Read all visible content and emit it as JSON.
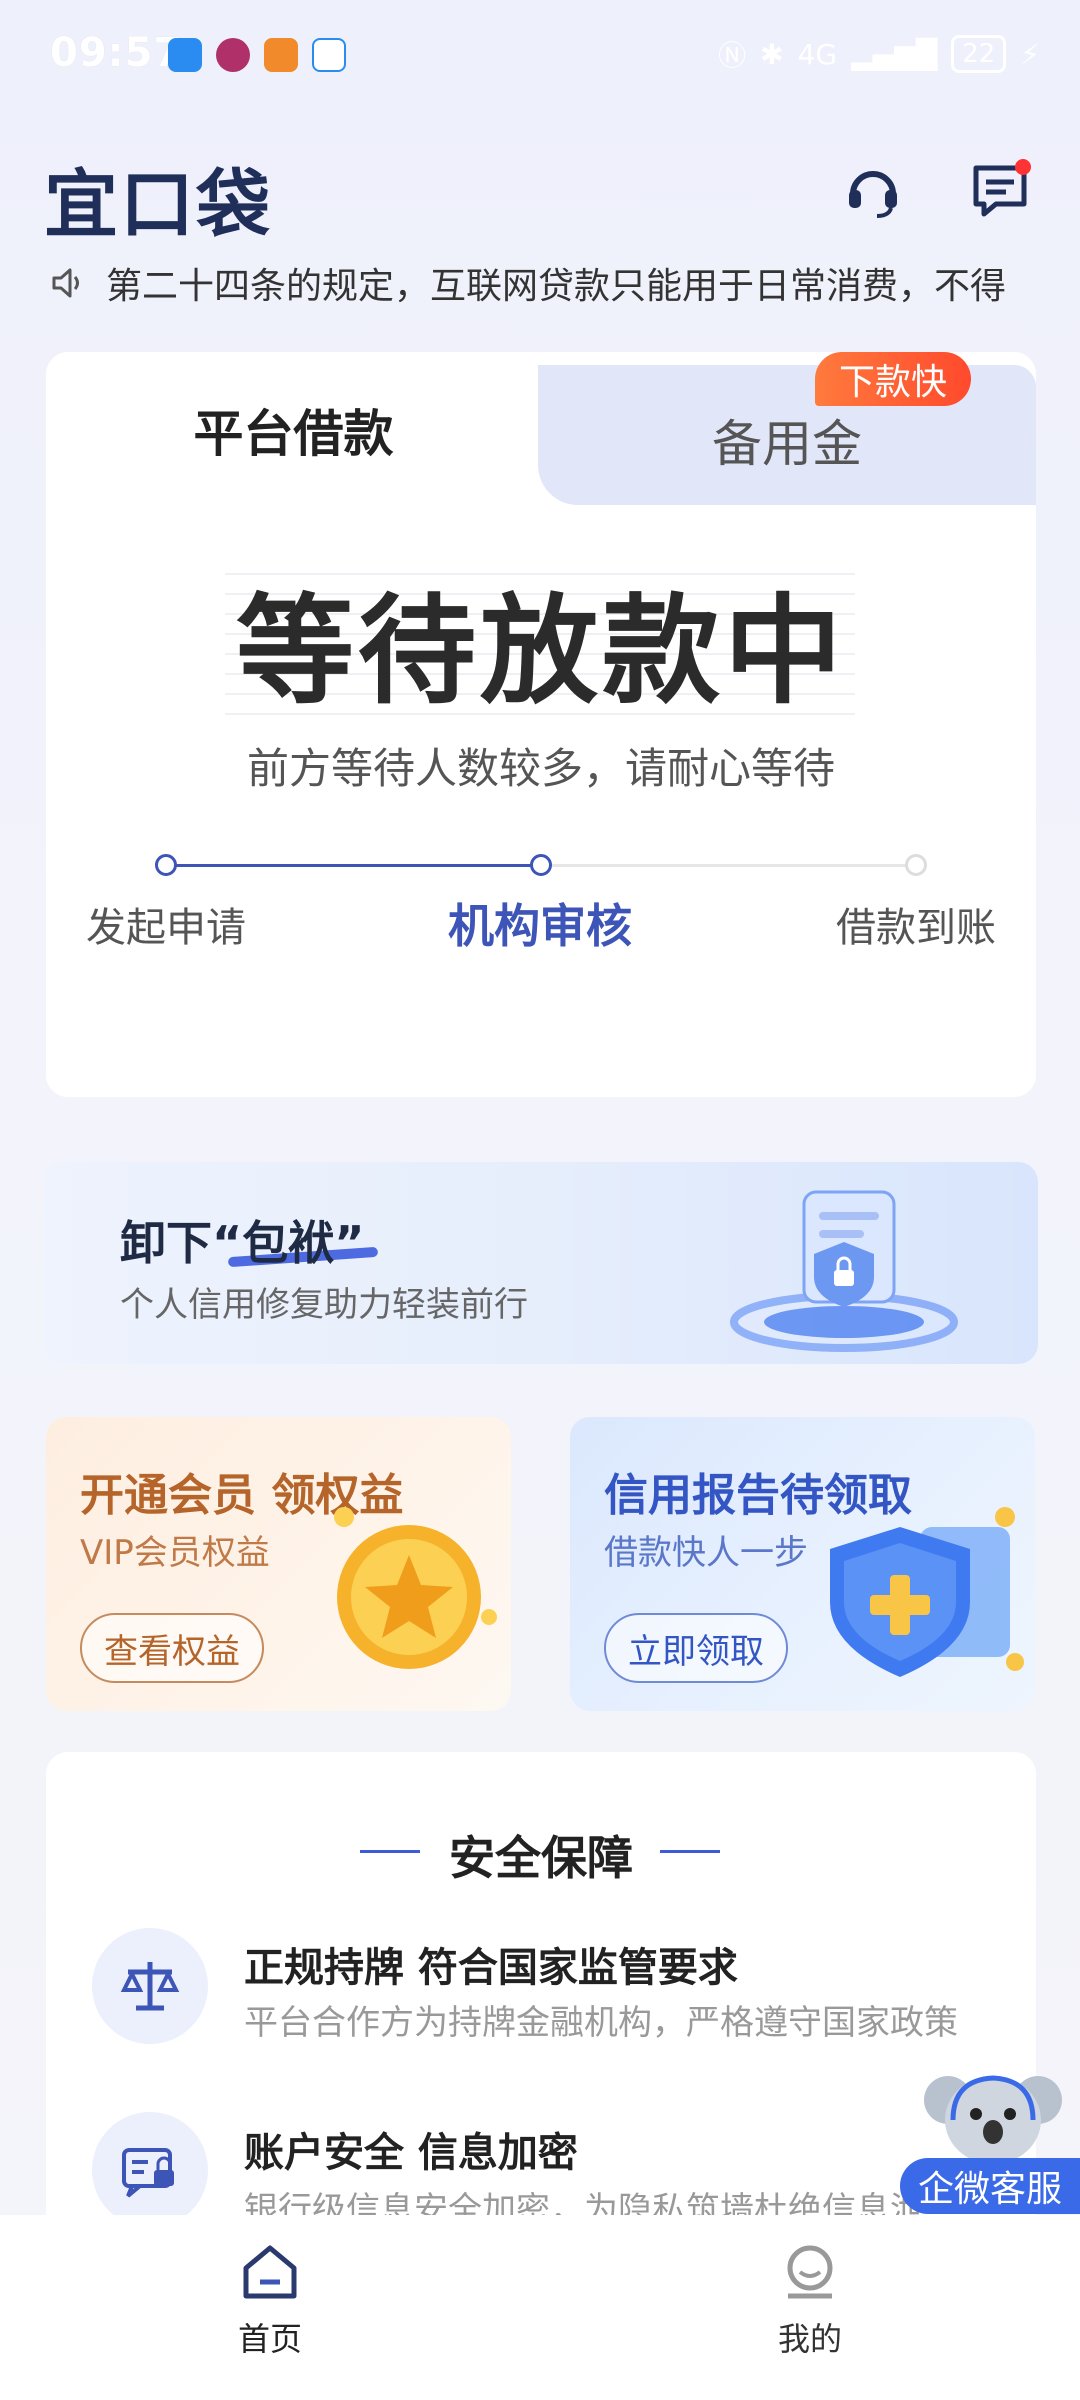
{
  "status_bar": {
    "time": "09:57",
    "battery": "22",
    "network": "4G"
  },
  "header": {
    "logo": "宜口袋",
    "service_icon": "headset-icon",
    "message_icon": "message-icon"
  },
  "notice": {
    "text": "第二十四条的规定，互联网贷款只能用于日常消费，不得"
  },
  "loan_card": {
    "tabs": [
      {
        "label": "平台借款",
        "active": true
      },
      {
        "label": "备用金",
        "active": false
      }
    ],
    "badge": "下款快",
    "status_title": "等待放款中",
    "status_subtitle": "前方等待人数较多，请耐心等待",
    "steps": [
      {
        "label": "发起申请",
        "state": "done"
      },
      {
        "label": "机构审核",
        "state": "current"
      },
      {
        "label": "借款到账",
        "state": "pending"
      }
    ]
  },
  "banner": {
    "title": "卸下“包袱”",
    "subtitle": "个人信用修复助力轻装前行"
  },
  "promos": [
    {
      "title": "开通会员 领权益",
      "subtitle": "VIP会员权益",
      "button": "查看权益"
    },
    {
      "title": "信用报告待领取",
      "subtitle": "借款快人一步",
      "button": "立即领取"
    }
  ],
  "safety": {
    "title": "安全保障",
    "items": [
      {
        "title": "正规持牌 符合国家监管要求",
        "subtitle": "平台合作方为持牌金融机构，严格遵守国家政策",
        "icon": "scale-icon"
      },
      {
        "title": "账户安全 信息加密",
        "subtitle": "银行级信息安全加密，为隐私筑墙杜绝信息泄露",
        "icon": "id-card-lock-icon"
      }
    ]
  },
  "customer_service": {
    "label": "企微客服"
  },
  "bottom_nav": {
    "items": [
      {
        "label": "首页",
        "active": true
      },
      {
        "label": "我的",
        "active": false
      }
    ]
  },
  "colors": {
    "accent": "#3e55b8",
    "badge": "#ff5a2d",
    "vip_text": "#b5642a",
    "credit_text": "#3356c4"
  }
}
